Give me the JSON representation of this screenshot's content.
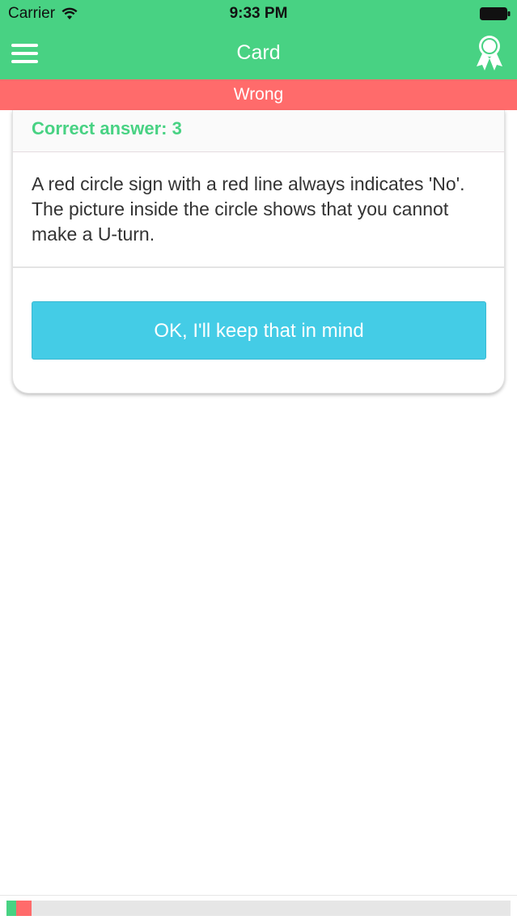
{
  "status_bar": {
    "carrier": "Carrier",
    "time": "9:33 PM",
    "icons": [
      "wifi-icon",
      "battery-icon"
    ]
  },
  "nav": {
    "title": "Card",
    "left_icon": "hamburger-menu-icon",
    "right_icon": "award-ribbon-icon"
  },
  "result": {
    "label": "Wrong",
    "color": "#ff6b6b"
  },
  "card": {
    "correct_answer": "Correct answer: 3",
    "explanation": "A red circle sign with a red line always indicates 'No'. The picture inside the circle shows that you cannot make a U-turn.",
    "ok_button_label": "OK, I'll keep that in mind"
  },
  "progress": {
    "segments": [
      {
        "status": "correct",
        "color": "#48d283",
        "fraction": 0.02
      },
      {
        "status": "wrong",
        "color": "#ff6b6b",
        "fraction": 0.03
      }
    ]
  },
  "colors": {
    "accent": "#48d283",
    "wrong": "#ff6b6b",
    "button": "#44cce6"
  }
}
